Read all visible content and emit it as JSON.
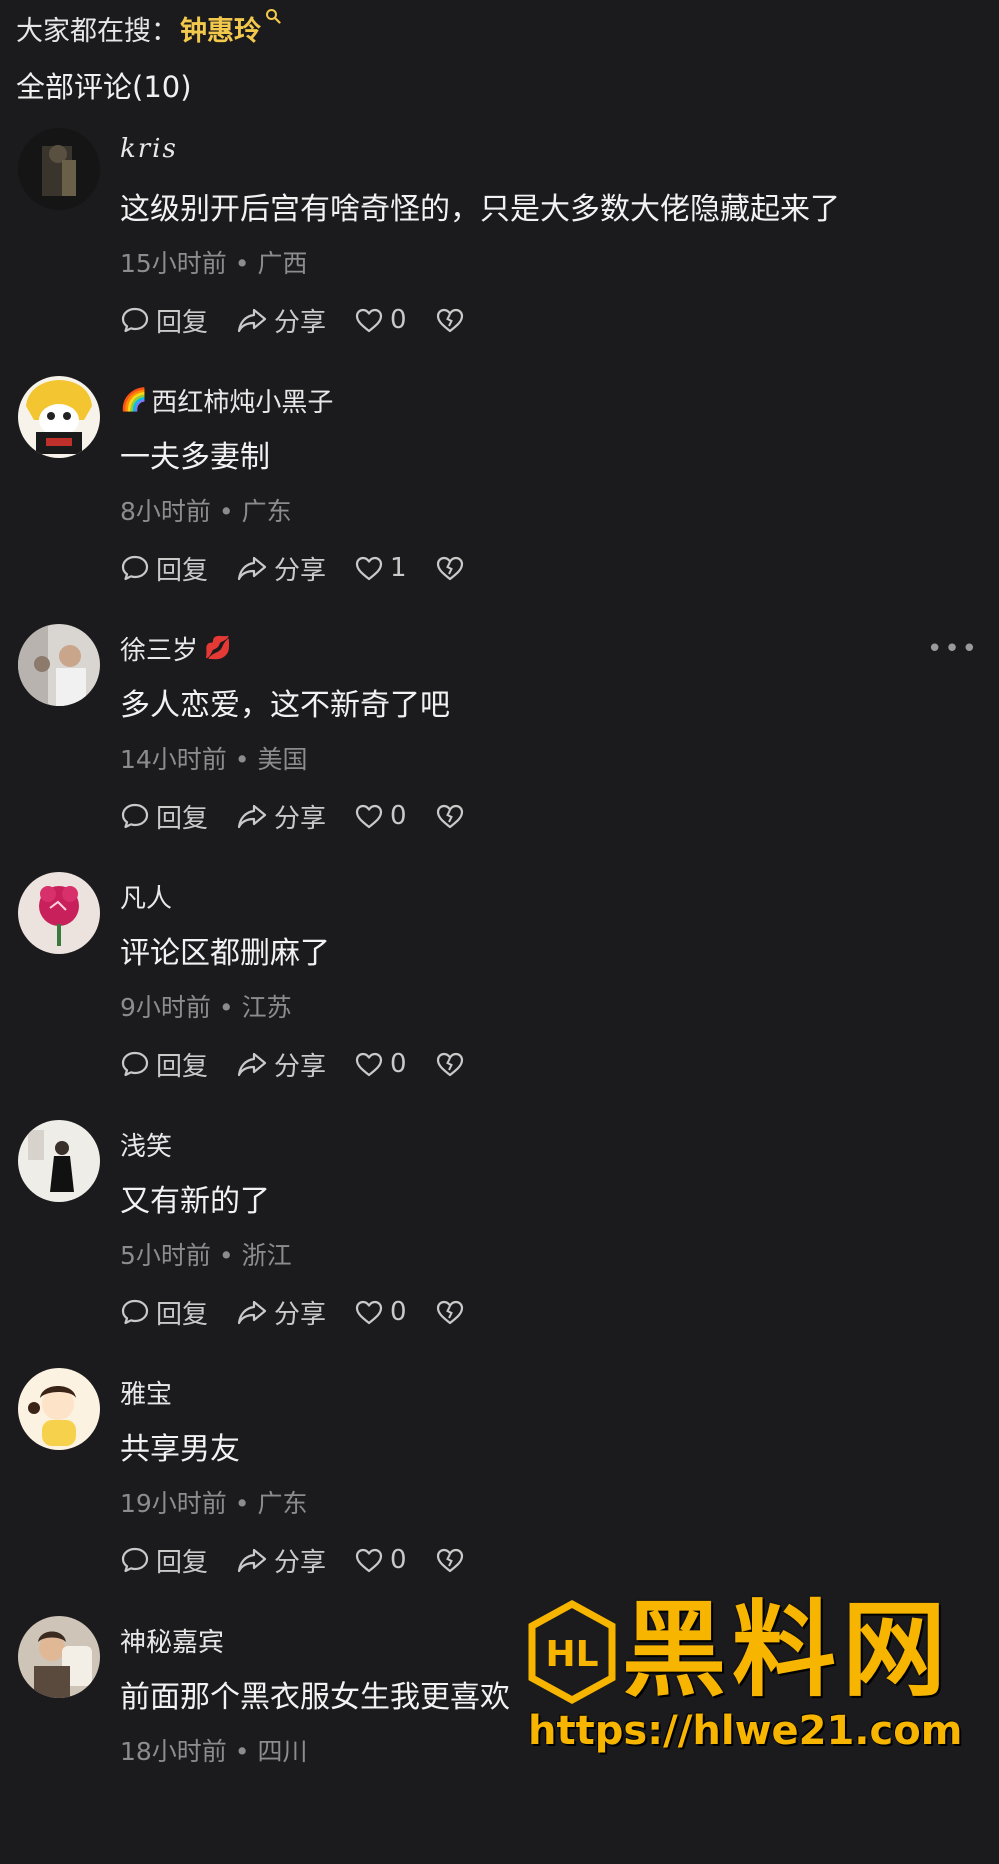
{
  "header": {
    "hot_search_label": "大家都在搜：",
    "hot_search_keyword": "钟惠玲",
    "comment_count_label": "全部评论(10)"
  },
  "actions": {
    "reply_label": "回复",
    "share_label": "分享"
  },
  "comments": [
    {
      "username": "kris",
      "content": "这级别开后宫有啥奇怪的，只是大多数大佬隐藏起来了",
      "time": "15小时前",
      "location": "广西",
      "likes": "0"
    },
    {
      "username": "西红柿炖小黑子",
      "content": "一夫多妻制",
      "time": "8小时前",
      "location": "广东",
      "likes": "1",
      "name_icon": "🌈"
    },
    {
      "username": "徐三岁",
      "content": "多人恋爱，这不新奇了吧",
      "time": "14小时前",
      "location": "美国",
      "likes": "0",
      "name_badge": "💋"
    },
    {
      "username": "凡人",
      "content": "评论区都删麻了",
      "time": "9小时前",
      "location": "江苏",
      "likes": "0"
    },
    {
      "username": "浅笑",
      "content": "又有新的了",
      "time": "5小时前",
      "location": "浙江",
      "likes": "0"
    },
    {
      "username": "雅宝",
      "content": "共享男友",
      "time": "19小时前",
      "location": "广东",
      "likes": "0"
    },
    {
      "username": "神秘嘉宾",
      "content": "前面那个黑衣服女生我更喜欢",
      "time": "18小时前",
      "location": "四川"
    }
  ],
  "watermark": {
    "title": "黑料网",
    "url": "https://hlwe21.com",
    "logo_text": "HL"
  },
  "colors": {
    "background": "#1b1b1d",
    "keyword": "#f2c94c",
    "watermark": "#f7b500",
    "meta_text": "#8c8c8e"
  },
  "icons": {
    "reply": "comment-bubble-icon",
    "share": "share-arrow-icon",
    "like": "heart-icon",
    "dislike": "broken-heart-icon",
    "more": "more-dots-icon"
  }
}
